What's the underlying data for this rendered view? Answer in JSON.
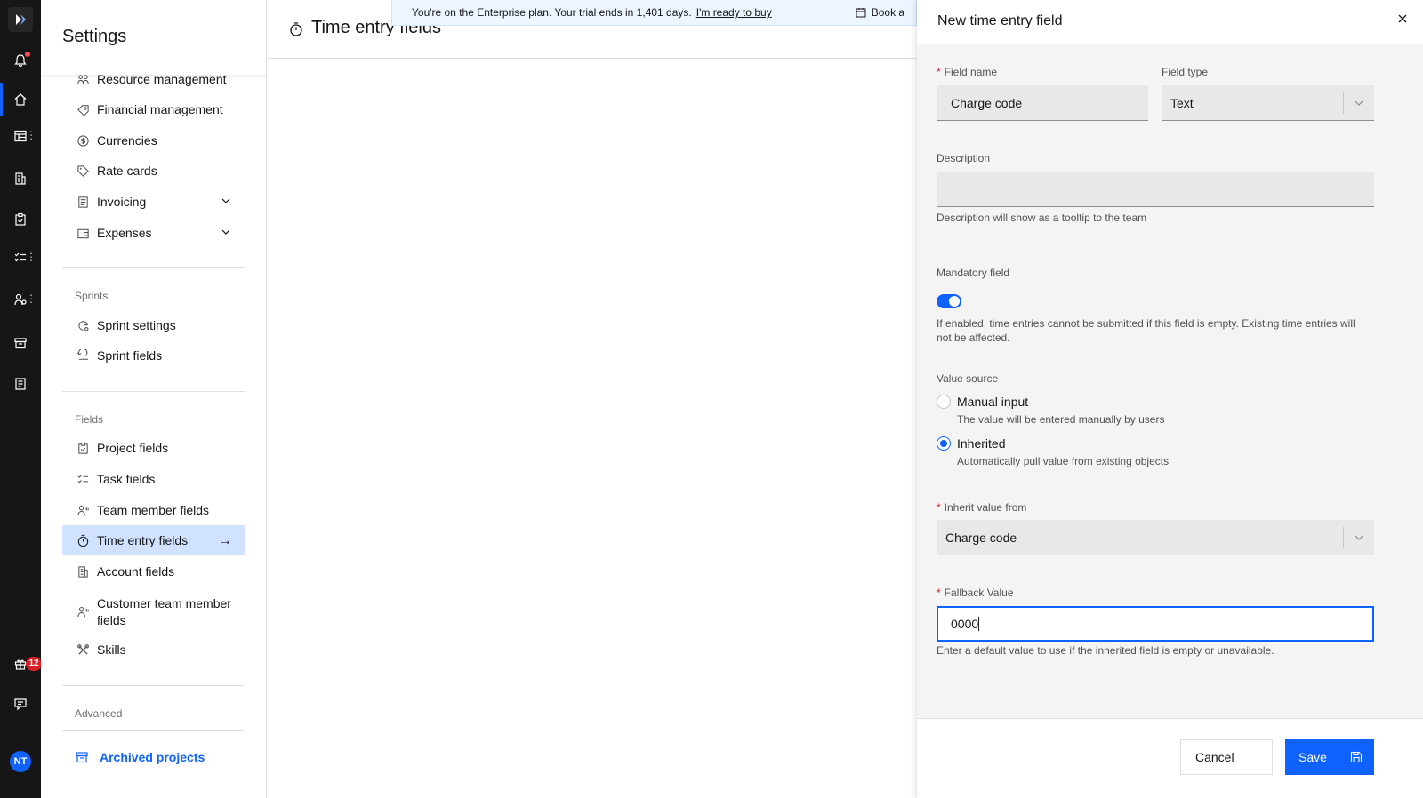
{
  "rail": {
    "notification_count": "12",
    "avatar_initials": "NT"
  },
  "sidebar": {
    "title": "Settings",
    "items_top": [
      {
        "label": "Resource management",
        "icon": "people-icon"
      },
      {
        "label": "Financial management",
        "icon": "finance-icon"
      },
      {
        "label": "Currencies",
        "icon": "currency-icon"
      },
      {
        "label": "Rate cards",
        "icon": "tag-icon"
      },
      {
        "label": "Invoicing",
        "icon": "invoice-icon"
      },
      {
        "label": "Expenses",
        "icon": "wallet-icon"
      }
    ],
    "sprints_section": "Sprints",
    "sprint_items": [
      {
        "label": "Sprint settings"
      },
      {
        "label": "Sprint fields"
      }
    ],
    "fields_section": "Fields",
    "field_items": [
      {
        "label": "Project fields"
      },
      {
        "label": "Task fields"
      },
      {
        "label": "Team member fields"
      },
      {
        "label": "Time entry fields"
      },
      {
        "label": "Account fields"
      },
      {
        "label": "Customer team member fields"
      },
      {
        "label": "Skills"
      }
    ],
    "advanced_section": "Advanced",
    "archived_label": "Archived projects"
  },
  "main": {
    "title": "Time entry fields"
  },
  "banner": {
    "text": "You're on the Enterprise plan. Your trial ends in 1,401 days.",
    "link": "I'm ready to buy",
    "book": "Book a"
  },
  "panel": {
    "title": "New time entry field",
    "field_name_label": "Field name",
    "field_name_value": "Charge code",
    "field_type_label": "Field type",
    "field_type_value": "Text",
    "description_label": "Description",
    "description_value": "",
    "description_helper": "Description will show as a tooltip to the team",
    "mandatory_label": "Mandatory field",
    "mandatory_enabled": true,
    "mandatory_helper": "If enabled, time entries cannot be submitted if this field is empty. Existing time entries will not be affected.",
    "value_source_label": "Value source",
    "manual_label": "Manual input",
    "manual_desc": "The value will be entered manually by users",
    "inherited_label": "Inherited",
    "inherited_desc": "Automatically pull value from existing objects",
    "inherit_from_label": "Inherit value from",
    "inherit_from_value": "Charge code",
    "fallback_label": "Fallback Value",
    "fallback_value": "0000",
    "fallback_helper": "Enter a default value to use if the inherited field is empty or unavailable.",
    "cancel_label": "Cancel",
    "save_label": "Save"
  },
  "colors": {
    "accent": "#0f62fe",
    "rail_bg": "#161616",
    "active_nav_bg": "#d0e2ff",
    "badge": "#da1e28"
  }
}
